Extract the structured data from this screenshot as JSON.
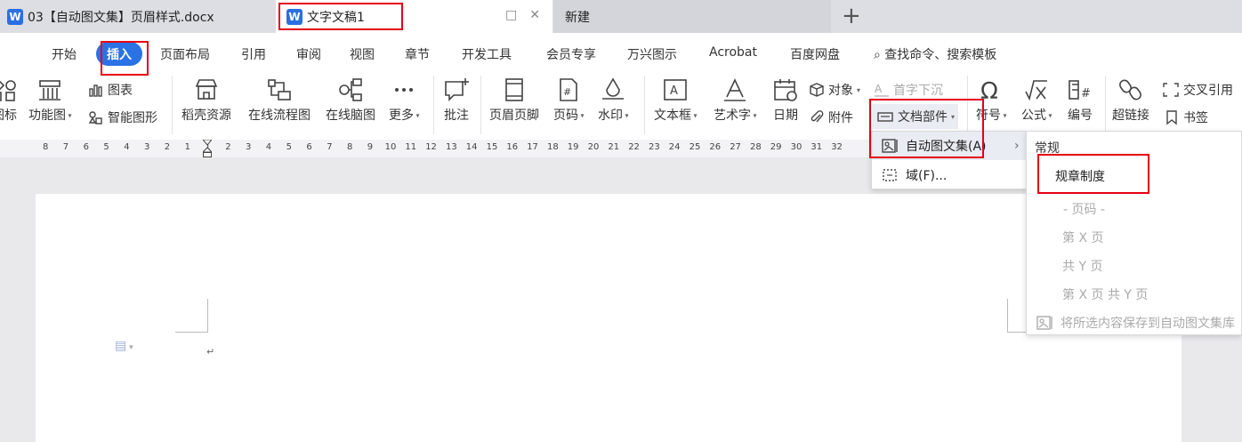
{
  "tabs": [
    {
      "label": "03【自动图文集】页眉样式.docx"
    },
    {
      "label": "文字文稿1"
    },
    {
      "label": "新建"
    }
  ],
  "tab_actions": {
    "pin": "□",
    "close": "✕",
    "new_tab": "+"
  },
  "menu": {
    "items": [
      "开始",
      "插入",
      "页面布局",
      "引用",
      "审阅",
      "视图",
      "章节",
      "开发工具",
      "会员专享",
      "万兴图示",
      "Acrobat",
      "百度网盘"
    ],
    "search": "查找命令、搜索模板"
  },
  "toolbar": {
    "icons_partial": "图标",
    "function_chart": "功能图",
    "chart": "图表",
    "smart_shape": "智能图形",
    "resource": "稻壳资源",
    "flowchart": "在线流程图",
    "mindmap": "在线脑图",
    "more": "更多",
    "comment": "批注",
    "header_footer": "页眉页脚",
    "page_number": "页码",
    "watermark": "水印",
    "textbox": "文本框",
    "wordart": "艺术字",
    "date": "日期",
    "object": "对象",
    "attachment": "附件",
    "drop_cap": "首字下沉",
    "doc_parts": "文档部件",
    "symbol": "符号",
    "formula": "公式",
    "numbering": "编号",
    "hyperlink": "超链接",
    "bookmark": "书签",
    "cross_ref": "交叉引用"
  },
  "ruler": [
    "8",
    "7",
    "6",
    "5",
    "4",
    "3",
    "2",
    "1",
    "1",
    "2",
    "3",
    "4",
    "5",
    "6",
    "7",
    "8",
    "9",
    "10",
    "11",
    "12",
    "13",
    "14",
    "15",
    "16",
    "17",
    "18",
    "19",
    "20",
    "21",
    "22",
    "23",
    "24",
    "25",
    "26",
    "27",
    "28",
    "29",
    "30",
    "31",
    "32"
  ],
  "doc_parts_menu": {
    "autotext": "自动图文集(A)",
    "field": "域(F)...",
    "submenu_arrow": "›"
  },
  "autotext_menu": {
    "section": "常规",
    "entries": [
      "规章制度"
    ],
    "disabled": [
      "- 页码 -",
      "第 X 页",
      "共 Y 页",
      "第 X 页 共 Y 页"
    ],
    "save": "将所选内容保存到自动图文集库"
  },
  "colors": {
    "accent": "#2a72e6",
    "highlight_box": "#e60012"
  }
}
